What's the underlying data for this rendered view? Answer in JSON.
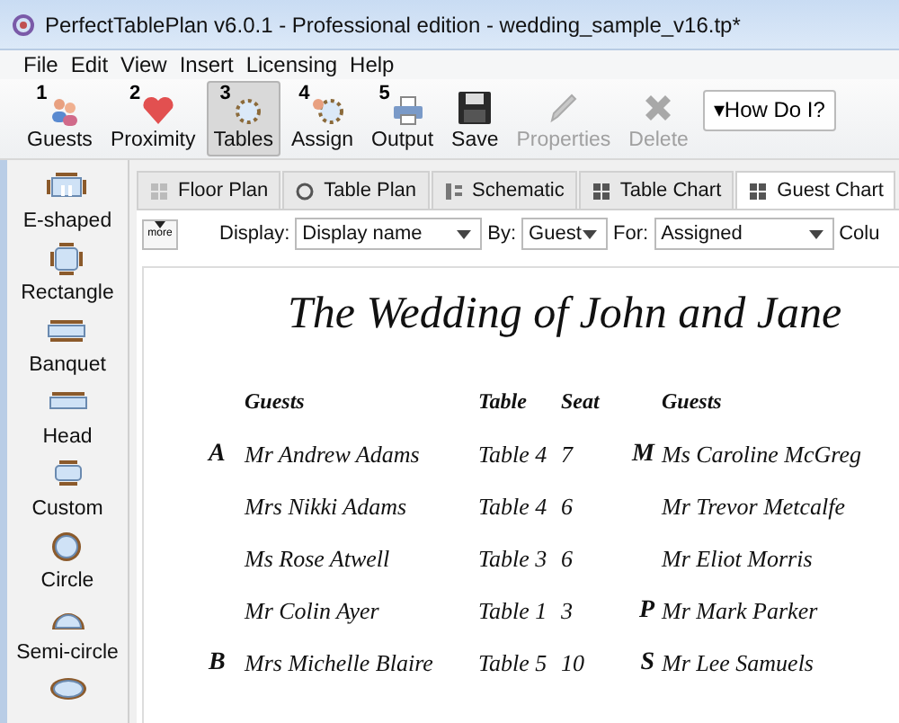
{
  "window": {
    "title": "PerfectTablePlan v6.0.1 - Professional edition - wedding_sample_v16.tp*"
  },
  "menu": [
    "File",
    "Edit",
    "View",
    "Insert",
    "Licensing",
    "Help"
  ],
  "toolbar": [
    {
      "number": "1",
      "label": "Guests",
      "selected": false,
      "disabled": false
    },
    {
      "number": "2",
      "label": "Proximity",
      "selected": false,
      "disabled": false
    },
    {
      "number": "3",
      "label": "Tables",
      "selected": true,
      "disabled": false
    },
    {
      "number": "4",
      "label": "Assign",
      "selected": false,
      "disabled": false
    },
    {
      "number": "5",
      "label": "Output",
      "selected": false,
      "disabled": false
    },
    {
      "label": "Save",
      "selected": false,
      "disabled": false
    },
    {
      "label": "Properties",
      "selected": false,
      "disabled": true
    },
    {
      "label": "Delete",
      "selected": false,
      "disabled": true
    }
  ],
  "help_button": "▾How Do I?",
  "sidebar": {
    "items": [
      "E-shaped",
      "Rectangle",
      "Banquet",
      "Head",
      "Custom",
      "Circle",
      "Semi-circle"
    ]
  },
  "tabs": [
    {
      "label": "Floor Plan",
      "selected": false
    },
    {
      "label": "Table Plan",
      "selected": false
    },
    {
      "label": "Schematic",
      "selected": false
    },
    {
      "label": "Table Chart",
      "selected": false
    },
    {
      "label": "Guest Chart",
      "selected": true
    }
  ],
  "options": {
    "more_button": "more",
    "display_label": "Display:",
    "display_value": "Display name",
    "by_label": "By:",
    "by_value": "Guest",
    "for_label": "For:",
    "for_value": "Assigned",
    "column_label": "Colu"
  },
  "chart": {
    "title": "The Wedding of John and Jane",
    "headers": [
      "Guests",
      "Table",
      "Seat",
      "Guests"
    ],
    "rows": [
      {
        "letter": "A",
        "guest": "Mr Andrew Adams",
        "table": "Table 4",
        "seat": "7",
        "letter_2": "M",
        "guest_2": "Ms Caroline McGreg"
      },
      {
        "guest": "Mrs Nikki Adams",
        "table": "Table 4",
        "seat": "6",
        "guest_2": "Mr Trevor Metcalfe"
      },
      {
        "guest": "Ms Rose Atwell",
        "table": "Table 3",
        "seat": "6",
        "guest_2": "Mr Eliot Morris"
      },
      {
        "guest": "Mr Colin Ayer",
        "table": "Table 1",
        "seat": "3",
        "letter_2": "P",
        "guest_2": "Mr Mark Parker"
      },
      {
        "letter": "B",
        "guest": "Mrs Michelle Blaire",
        "table": "Table 5",
        "seat": "10",
        "letter_2": "S",
        "guest_2": "Mr Lee Samuels"
      }
    ]
  }
}
